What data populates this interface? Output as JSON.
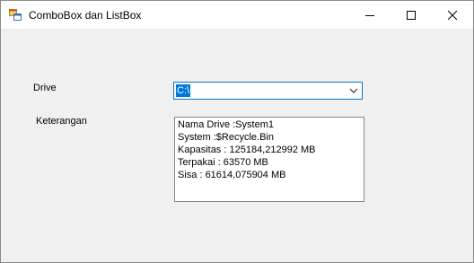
{
  "window": {
    "title": "ComboBox dan ListBox",
    "controls": [
      "minimize-icon",
      "maximize-icon",
      "close-icon"
    ]
  },
  "form": {
    "drive_label": "Drive",
    "drive_value": "C:\\",
    "keterangan_label": "Keterangan",
    "list_items": [
      "Nama Drive :System1",
      "System :$Recycle.Bin",
      "Kapasitas : 125184,212992 MB",
      "Terpakai : 63570 MB",
      "Sisa : 61614,075904 MB"
    ]
  },
  "colors": {
    "accent": "#0078d7",
    "form_background": "#f0f0f0"
  }
}
